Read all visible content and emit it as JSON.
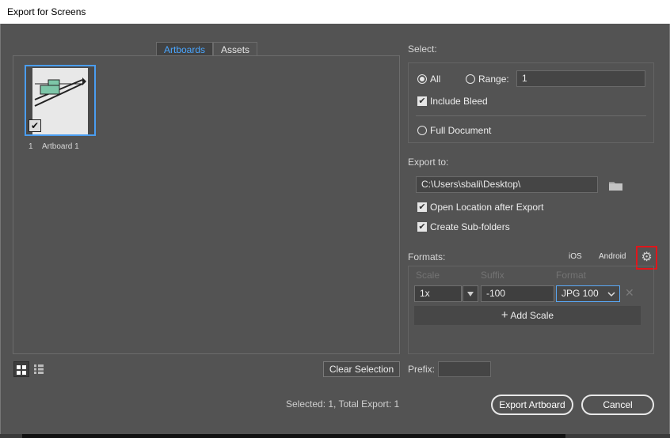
{
  "window": {
    "title": "Export for Screens"
  },
  "tabs": [
    {
      "label": "Artboards",
      "active": true
    },
    {
      "label": "Assets",
      "active": false
    }
  ],
  "artboards": [
    {
      "number": "1",
      "name": "Artboard 1",
      "selected": true
    }
  ],
  "left_footer": {
    "clear_selection": "Clear Selection",
    "status": "Selected: 1, Total Export: 1"
  },
  "select": {
    "label": "Select:",
    "all_label": "All",
    "range_label": "Range:",
    "range_value": "1",
    "include_bleed_label": "Include Bleed",
    "full_document_label": "Full Document",
    "selected_option": "All"
  },
  "export_to": {
    "label": "Export to:",
    "path": "C:\\Users\\sbali\\Desktop\\",
    "open_location_label": "Open Location after Export",
    "sub_folders_label": "Create Sub-folders"
  },
  "formats": {
    "label": "Formats:",
    "ios": "iOS",
    "android": "Android",
    "columns": {
      "scale": "Scale",
      "suffix": "Suffix",
      "format": "Format"
    },
    "rows": [
      {
        "scale": "1x",
        "suffix": "-100",
        "format": "JPG 100"
      }
    ],
    "add_scale": "Add Scale"
  },
  "prefix": {
    "label": "Prefix:",
    "value": ""
  },
  "actions": {
    "export": "Export Artboard",
    "cancel": "Cancel"
  },
  "colors": {
    "accent": "#4aa6ff",
    "highlight": "#e0161b",
    "background": "#535353"
  }
}
